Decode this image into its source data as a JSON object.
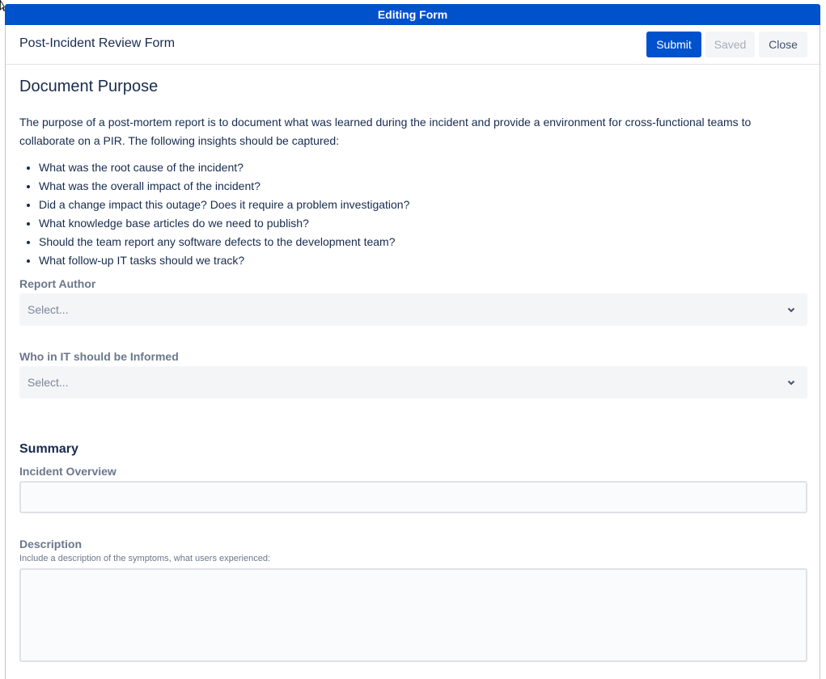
{
  "banner": {
    "title": "Editing Form"
  },
  "header": {
    "form_title": "Post-Incident Review Form",
    "submit_label": "Submit",
    "saved_label": "Saved",
    "close_label": "Close"
  },
  "purpose": {
    "heading": "Document Purpose",
    "intro": "The purpose  of a post-mortem report is to document what was learned during the incident and provide a environment for cross-functional teams to collaborate on a PIR.  The following insights should be captured:",
    "bullets": [
      "What was the root cause of the incident?",
      "What was the overall impact of the incident?",
      "Did a change impact this outage?  Does it require a problem investigation?",
      "What knowledge base articles do we need to publish?",
      "Should the team report any software defects to the development team?",
      "What follow-up IT tasks should we track?"
    ]
  },
  "fields": {
    "report_author": {
      "label": "Report Author",
      "placeholder": "Select..."
    },
    "informed": {
      "label": "Who in IT should be Informed",
      "placeholder": "Select..."
    }
  },
  "summary": {
    "heading": "Summary",
    "overview_label": "Incident  Overview",
    "overview_value": "",
    "description_label": "Description",
    "description_hint": "Include a description of the symptoms, what users experienced:",
    "description_value": ""
  },
  "colors": {
    "brand": "#0052cc",
    "field_bg": "#f4f5f7",
    "label": "#6b778c"
  },
  "icons": {
    "dropdown": "chevron-down-icon",
    "cursor": "mouse-pointer-icon"
  }
}
